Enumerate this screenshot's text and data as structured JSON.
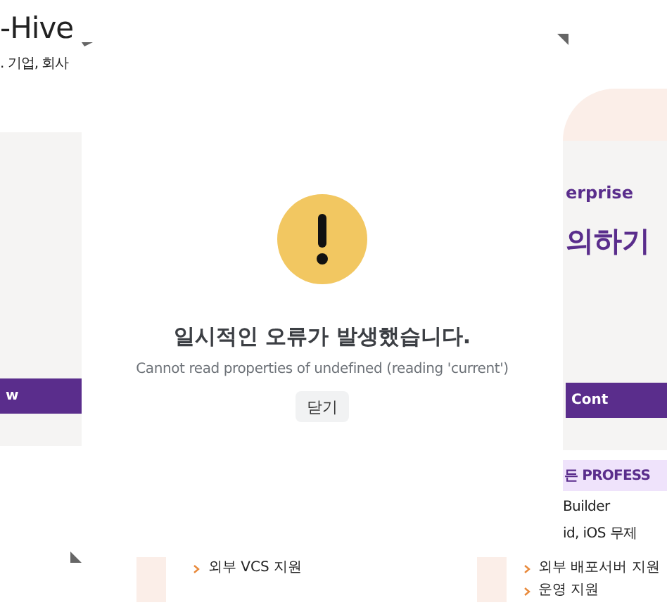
{
  "background_page": {
    "left_panel": {
      "title": "-Hive",
      "subtitle": ". 기업, 회사",
      "button": "w"
    },
    "right_panel": {
      "eyebrow": "erprise",
      "heading": "의하기",
      "button": "Cont",
      "plan_banner": "든 PROFESS",
      "features": [
        "Builder",
        "id, iOS 무제"
      ]
    },
    "bottom_lists": [
      {
        "items": [
          "외부 VCS 지원"
        ]
      },
      {
        "items": [
          "외부 배포서버 지원",
          "운영 지원"
        ]
      }
    ]
  },
  "error_dialog": {
    "title": "일시적인 오류가 발생했습니다.",
    "message": "Cannot read properties of undefined (reading 'current')",
    "close_button": "닫기"
  }
}
